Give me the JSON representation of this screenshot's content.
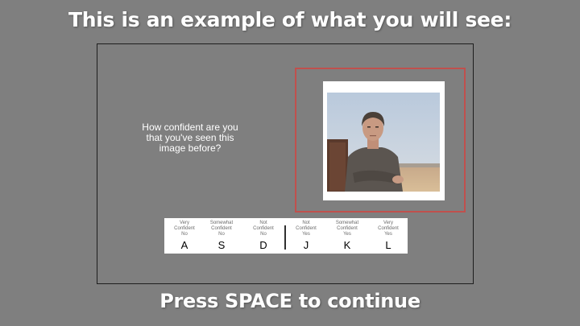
{
  "heading": "This is an example of what you will see:",
  "footer": "Press SPACE to continue",
  "trial": {
    "question_lines": [
      "How confident are you",
      "that you've seen this",
      "image before?"
    ]
  },
  "confidence_scale": [
    {
      "lines": [
        "Very",
        "Confident",
        "No"
      ],
      "key": "A"
    },
    {
      "lines": [
        "Somewhat",
        "Confident",
        "No"
      ],
      "key": "S"
    },
    {
      "lines": [
        "Not",
        "Confident",
        "No"
      ],
      "key": "D"
    },
    {
      "lines": [
        "Not",
        "Confident",
        "Yes"
      ],
      "key": "J"
    },
    {
      "lines": [
        "Somewhat",
        "Confident",
        "Yes"
      ],
      "key": "K"
    },
    {
      "lines": [
        "Very",
        "Confident",
        "Yes"
      ],
      "key": "L"
    }
  ],
  "colors": {
    "background": "#7f7f7f",
    "frame_border": "#c0504d",
    "text": "#ffffff"
  }
}
